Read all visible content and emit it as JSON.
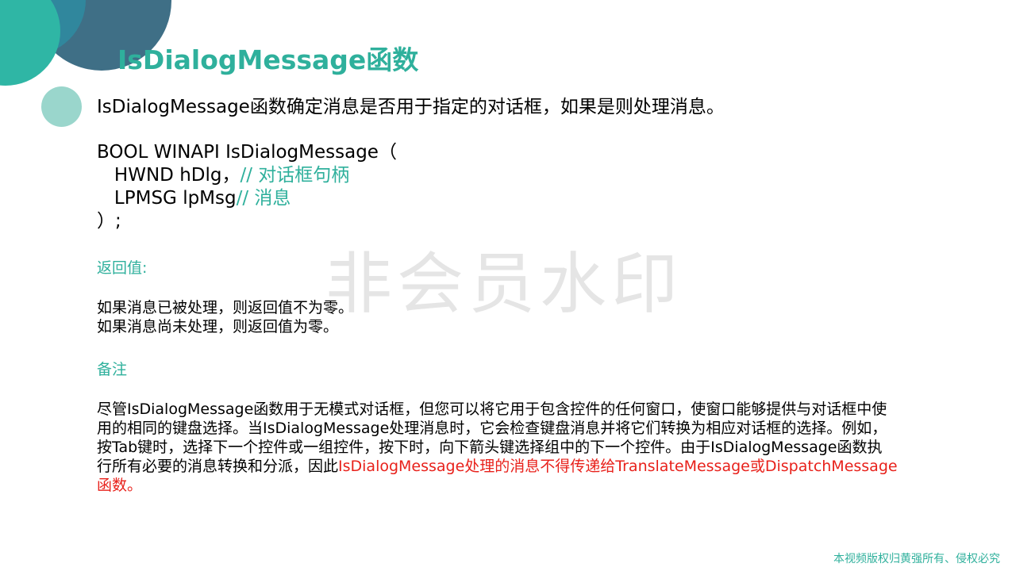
{
  "slide": {
    "title": "IsDialogMessage函数",
    "intro": "IsDialogMessage函数确定消息是否用于指定的对话框，如果是则处理消息。",
    "code": {
      "line1": "BOOL WINAPI IsDialogMessage（",
      "line2_code": "   HWND hDlg，",
      "line2_comment": "// 对话框句柄",
      "line3_code": "   LPMSG lpMsg",
      "line3_comment": "// 消息",
      "line4": "）;"
    },
    "return_label": "返回值:",
    "return_lines": [
      "如果消息已被处理，则返回值不为零。",
      "如果消息尚未处理，则返回值为零。"
    ],
    "remarks_label": "备注",
    "remarks": {
      "line1": "尽管IsDialogMessage函数用于无模式对话框，但您可以将它用于包含控件的任何窗口，使窗口能够提供与对话框中使",
      "line2": "用的相同的键盘选择。当IsDialogMessage处理消息时，它会检查键盘消息并将它们转换为相应对话框的选择。例如，",
      "line3": "按Tab键时，选择下一个控件或一组控件，按下时，向下箭头键选择组中的下一个控件。由于IsDialogMessage函数执",
      "line4_plain": "行所有必要的消息转换和分派，因此",
      "line4_red": "IsDialogMessage处理的消息不得传递给TranslateMessage或DispatchMessage",
      "line5_red": "函数。"
    },
    "watermark": "非会员水印",
    "copyright": "本视频版权归黄强所有、侵权必究"
  },
  "colors": {
    "accent": "#2fb09c",
    "warning_text": "#e8211b",
    "decor_dark": "#3f6f86",
    "decor_teal": "#2fb6a5",
    "decor_light": "#9ad6cc"
  }
}
